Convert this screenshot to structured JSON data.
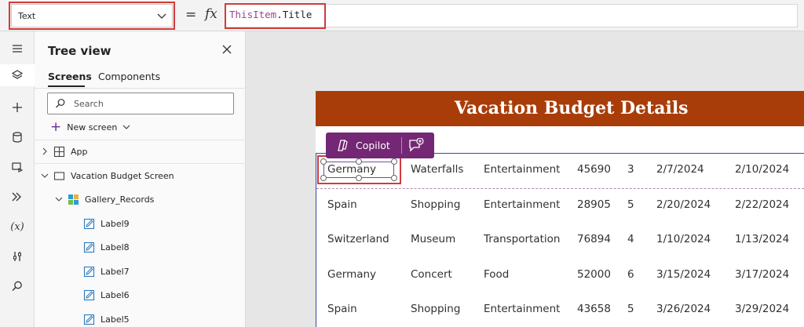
{
  "formula_bar": {
    "property": "Text",
    "equals": "=",
    "fx": "fx",
    "formula_keyword": "ThisItem",
    "formula_dot": ".",
    "formula_prop": "Title"
  },
  "rail": {
    "icons": [
      "menu-icon",
      "layers-icon",
      "insert-icon",
      "data-icon",
      "media-icon",
      "power-automate-icon",
      "variables-icon",
      "tools-icon",
      "search-icon"
    ],
    "variables_label": "(x)"
  },
  "tree": {
    "title": "Tree view",
    "tabs": [
      "Screens",
      "Components"
    ],
    "search_placeholder": "Search",
    "new_screen": "New screen",
    "nodes": [
      {
        "label": "App",
        "kind": "app"
      },
      {
        "label": "Vacation Budget Screen",
        "kind": "screen"
      },
      {
        "label": "Gallery_Records",
        "kind": "gallery"
      },
      {
        "label": "Label9",
        "kind": "label"
      },
      {
        "label": "Label8",
        "kind": "label"
      },
      {
        "label": "Label7",
        "kind": "label"
      },
      {
        "label": "Label6",
        "kind": "label"
      },
      {
        "label": "Label5",
        "kind": "label"
      }
    ]
  },
  "app": {
    "title": "Vacation Budget Details",
    "copilot_label": "Copilot",
    "rows": [
      [
        "Germany",
        "Waterfalls",
        "Entertainment",
        "45690",
        "3",
        "2/7/2024",
        "2/10/2024"
      ],
      [
        "Spain",
        "Shopping",
        "Entertainment",
        "28905",
        "5",
        "2/20/2024",
        "2/22/2024"
      ],
      [
        "Switzerland",
        "Museum",
        "Transportation",
        "76894",
        "4",
        "1/10/2024",
        "1/13/2024"
      ],
      [
        "Germany",
        "Concert",
        "Food",
        "52000",
        "6",
        "3/15/2024",
        "3/17/2024"
      ],
      [
        "Spain",
        "Shopping",
        "Entertainment",
        "43658",
        "5",
        "3/26/2024",
        "3/29/2024"
      ]
    ]
  },
  "colors": {
    "header": "#a93d09",
    "copilot": "#742774",
    "highlight": "#d33a3a",
    "formula_keyword": "#a0438f"
  }
}
